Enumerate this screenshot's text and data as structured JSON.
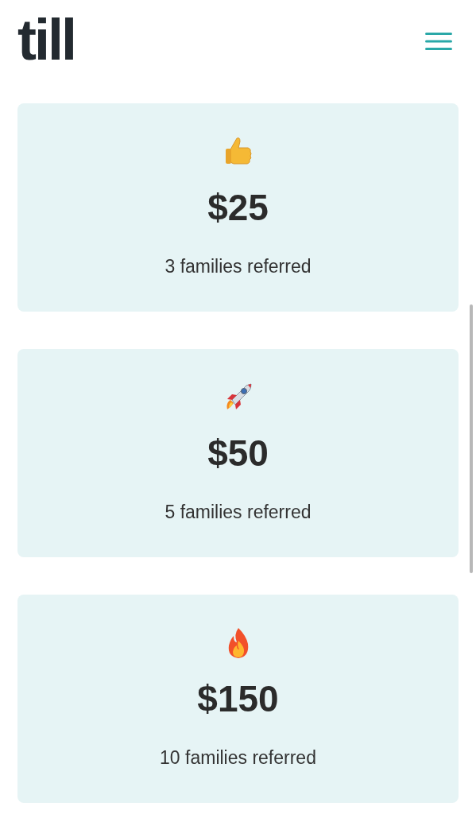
{
  "header": {
    "logo": "till"
  },
  "rewards": [
    {
      "kind": "thumbs-up",
      "amount": "$25",
      "description": "3 families referred"
    },
    {
      "kind": "rocket",
      "amount": "$50",
      "description": "5 families referred"
    },
    {
      "kind": "fire",
      "amount": "$150",
      "description": "10 families referred"
    }
  ]
}
